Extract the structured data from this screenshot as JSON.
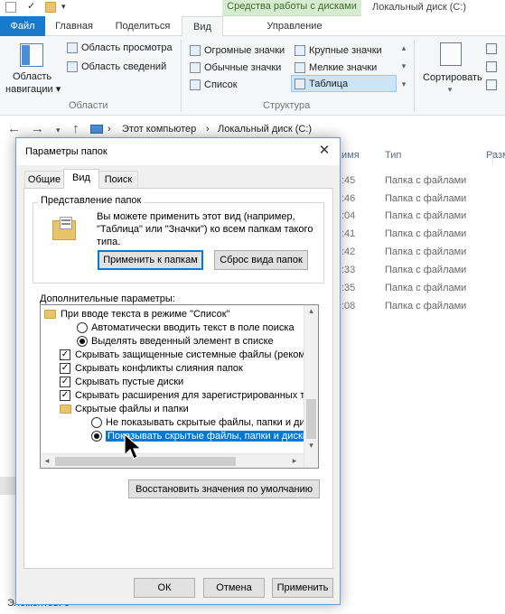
{
  "ribbon_tabs": {
    "file": "Файл",
    "home": "Главная",
    "share": "Поделиться",
    "view": "Вид",
    "manage": "Управление"
  },
  "context_group": "Средства работы с дисками",
  "window_title": "Локальный диск (C:)",
  "ribbon": {
    "nav_pane": "Область",
    "nav_pane2": "навигации",
    "preview_pane": "Область просмотра",
    "details_pane": "Область сведений",
    "panes_group": "Области",
    "layout_items": [
      "Огромные значки",
      "Крупные значки",
      "Обычные значки",
      "Мелкие значки",
      "Список",
      "Таблица"
    ],
    "layout_group": "Структура",
    "sort_by": "Сортировать"
  },
  "address": {
    "crumb1": "Этот компьютер",
    "crumb2": "Локальный диск (C:)"
  },
  "columns": {
    "name": "имя",
    "type": "Тип",
    "size": "Разм"
  },
  "rows": [
    {
      "time": ":45",
      "type": "Папка с файлами"
    },
    {
      "time": ":46",
      "type": "Папка с файлами"
    },
    {
      "time": ":04",
      "type": "Папка с файлами"
    },
    {
      "time": ":41",
      "type": "Папка с файлами"
    },
    {
      "time": ":42",
      "type": "Папка с файлами"
    },
    {
      "time": ":33",
      "type": "Папка с файлами"
    },
    {
      "time": ":35",
      "type": "Папка с файлами"
    },
    {
      "time": ":08",
      "type": "Папка с файлами"
    }
  ],
  "status_bar": "Элементов: 8",
  "dialog": {
    "title": "Параметры папок",
    "close_glyph": "✕",
    "tabs": [
      "Общие",
      "Вид",
      "Поиск"
    ],
    "folder_views_label": "Представление папок",
    "folder_views_text": "Вы можете применить этот вид (например, \"Таблица\" или \"Значки\") ко всем папкам такого типа.",
    "apply_to_folders": "Применить к папкам",
    "reset_folders": "Сброс вида папок",
    "advanced_label": "Дополнительные параметры:",
    "advanced_items": [
      {
        "text": "При вводе текста в режиме \"Список\""
      },
      {
        "text": "Автоматически вводить текст в поле поиска",
        "checked": false
      },
      {
        "text": "Выделять введенный элемент в списке",
        "checked": true
      },
      {
        "text": "Скрывать защищенные системные файлы (рекомен",
        "checked": true
      },
      {
        "text": "Скрывать конфликты слияния папок",
        "checked": true
      },
      {
        "text": "Скрывать пустые диски",
        "checked": true
      },
      {
        "text": "Скрывать расширения для зарегистрированных типо",
        "checked": true
      },
      {
        "text": "Скрытые файлы и папки"
      },
      {
        "text": "Не показывать скрытые файлы, папки и диски",
        "checked": false
      },
      {
        "text": "Показывать скрытые файлы, папки и диски",
        "checked": true,
        "selected": true
      }
    ],
    "restore_defaults": "Восстановить значения по умолчанию",
    "ok": "ОК",
    "cancel": "Отмена",
    "apply": "Применить"
  }
}
